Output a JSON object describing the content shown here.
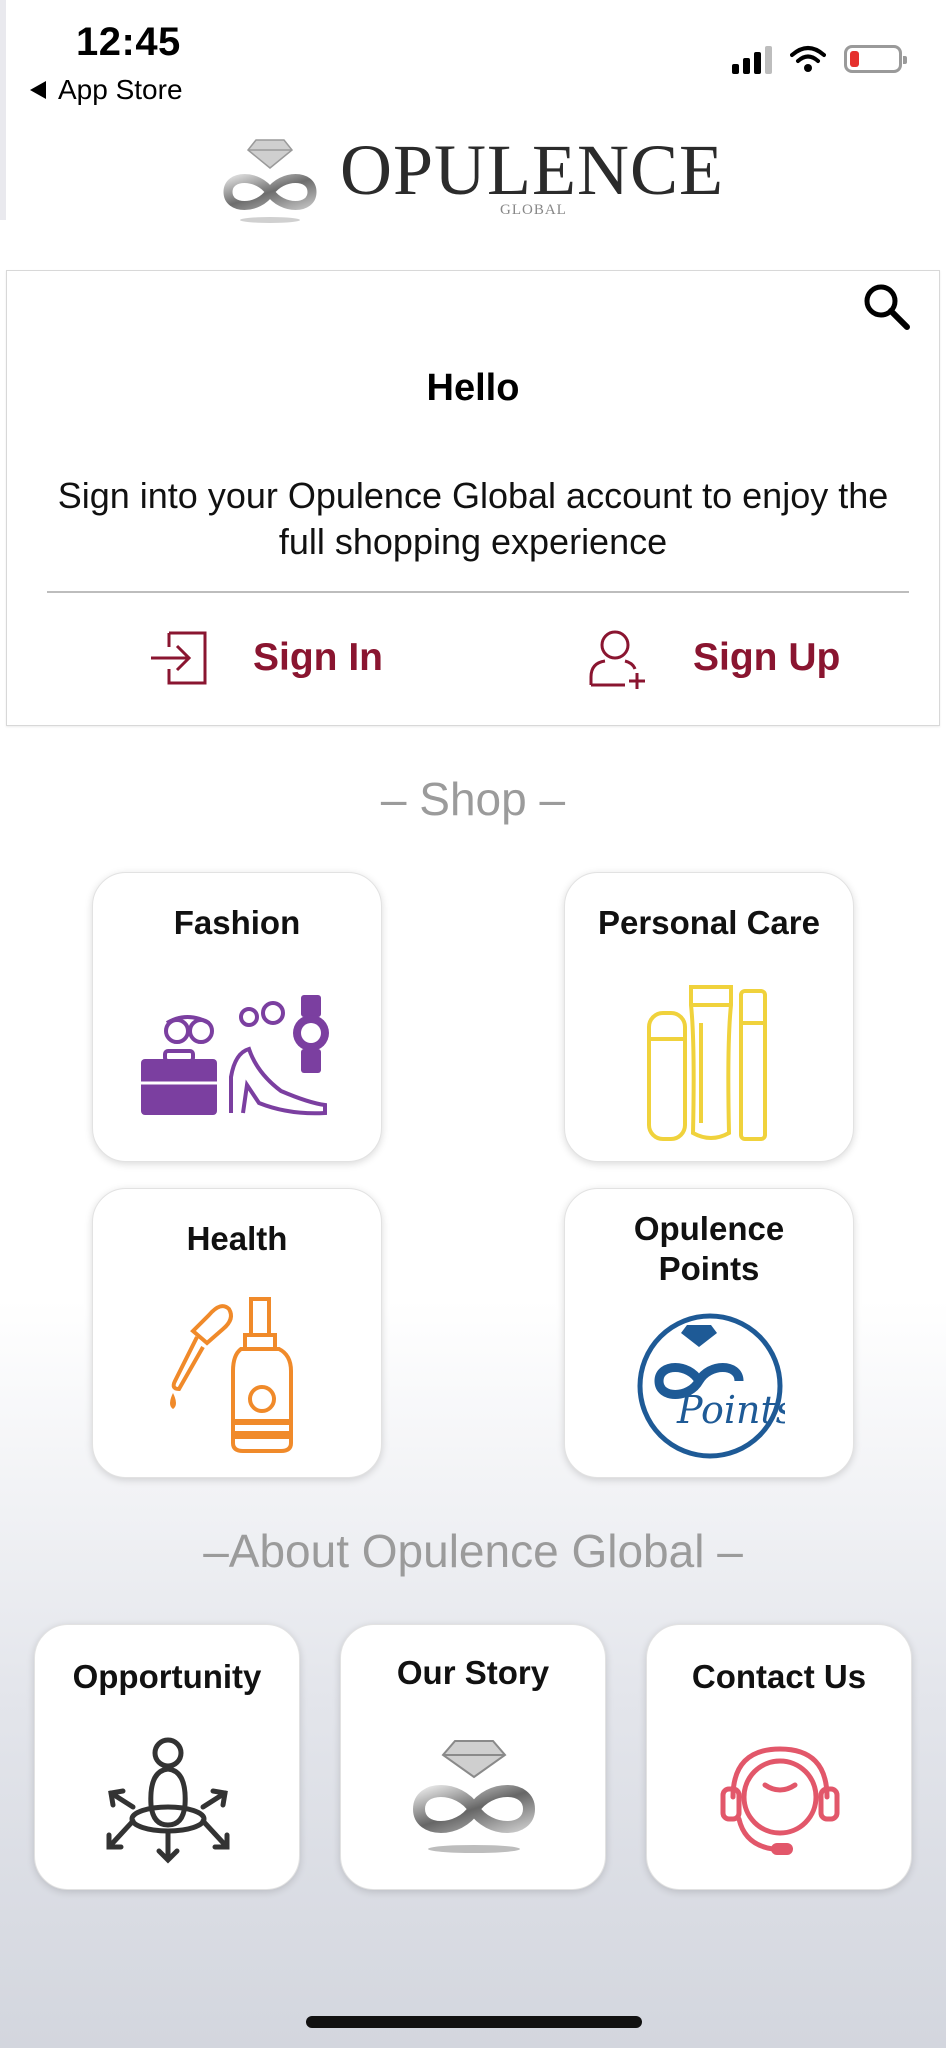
{
  "status_bar": {
    "time": "12:45",
    "back_label": "App Store"
  },
  "logo": {
    "title": "OPULENCE",
    "subtitle": "GLOBAL"
  },
  "hello_card": {
    "title": "Hello",
    "message": "Sign into your Opulence Global account to enjoy the full shopping experience",
    "sign_in_label": "Sign In",
    "sign_up_label": "Sign Up"
  },
  "shop": {
    "heading": "– Shop –",
    "tiles": [
      {
        "label": "Fashion",
        "icon": "fashion-accessories-icon"
      },
      {
        "label": "Personal Care",
        "icon": "cosmetic-tubes-icon"
      },
      {
        "label": "Health",
        "icon": "dropper-bottle-icon"
      },
      {
        "label": "Opulence Points",
        "icon": "points-logo-icon"
      }
    ]
  },
  "about": {
    "heading": "–About Opulence Global –",
    "tiles": [
      {
        "label": "Opportunity",
        "icon": "person-arrows-icon"
      },
      {
        "label": "Our Story",
        "icon": "infinity-diamond-icon"
      },
      {
        "label": "Contact Us",
        "icon": "headset-icon"
      }
    ]
  },
  "colors": {
    "accent": "#8a1530",
    "fashion": "#7b3fa0",
    "personal_care": "#f0d23c",
    "health": "#f08a2a",
    "points": "#1e5a96",
    "contact": "#e2576a",
    "section_heading": "#9b9b9b"
  }
}
